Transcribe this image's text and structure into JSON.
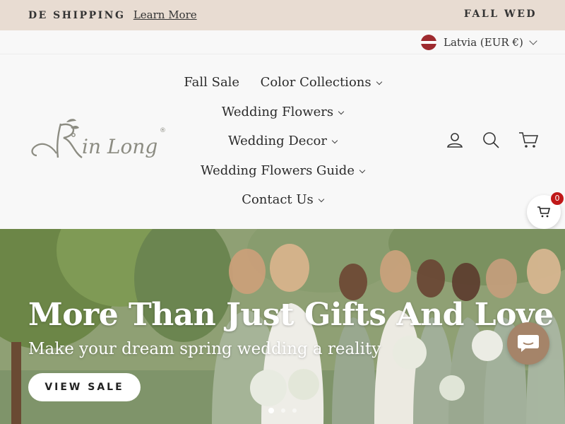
{
  "announcement": {
    "left_text": "DE SHIPPING",
    "left_link": "Learn More",
    "right_text": "FALL WED"
  },
  "locale": {
    "country": "Latvia (EUR €)",
    "flag_icon": "latvia-flag-icon"
  },
  "logo": {
    "text": "Rin Long",
    "trademark": "®"
  },
  "nav": {
    "items": [
      {
        "label": "Fall Sale",
        "has_dropdown": false
      },
      {
        "label": "Color Collections",
        "has_dropdown": true
      },
      {
        "label": "Wedding Flowers",
        "has_dropdown": true
      },
      {
        "label": "Wedding Decor",
        "has_dropdown": true
      },
      {
        "label": "Wedding Flowers Guide",
        "has_dropdown": true
      },
      {
        "label": "Contact Us",
        "has_dropdown": true
      }
    ]
  },
  "header_icons": [
    "account-icon",
    "search-icon",
    "cart-icon"
  ],
  "floating_cart": {
    "count": "0"
  },
  "hero": {
    "title": "More Than Just Gifts And Love",
    "subtitle": "Make your dream spring wedding a reality",
    "button_label": "VIEW SALE",
    "slides": 3,
    "active_slide": 1
  },
  "colors": {
    "announcement_bg": "#e8dcd2",
    "header_bg": "#f8f8f8",
    "chat_button": "#a58469",
    "badge": "#c01818"
  }
}
